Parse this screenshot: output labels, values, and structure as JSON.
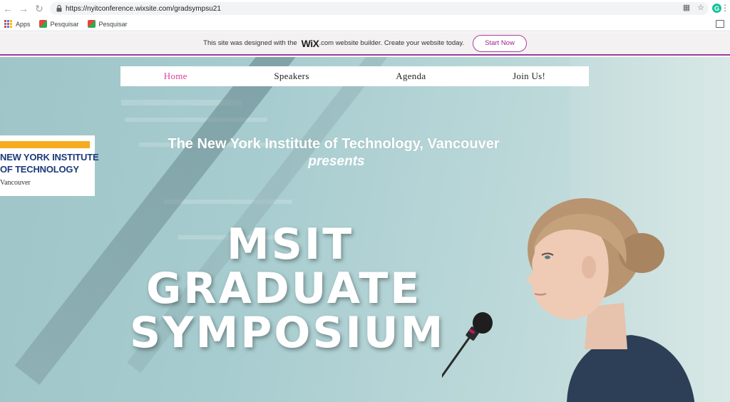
{
  "browser": {
    "url": "https://nyitconference.wixsite.com/gradsympsu21",
    "bookmarks": [
      "Apps",
      "Pesquisar",
      "Pesquisar"
    ],
    "extension_letter": "G"
  },
  "wix_banner": {
    "text_before": "This site was designed with the",
    "logo": "WiX",
    "text_after": ".com website builder. Create your website today.",
    "button": "Start Now",
    "accent_color": "#b03da0"
  },
  "nav": {
    "items": [
      "Home",
      "Speakers",
      "Agenda",
      "Join Us!"
    ],
    "active": "Home",
    "active_color": "#d6449a"
  },
  "logo": {
    "line1": "NEW YORK INSTITUTE",
    "line2": "OF TECHNOLOGY",
    "line3": "Vancouver"
  },
  "hero": {
    "institution": "The New York Institute of Technology, Vancouver",
    "presents": "presents",
    "title_lines": [
      "MSIT",
      "GRADUATE",
      "SYMPOSIUM"
    ]
  }
}
